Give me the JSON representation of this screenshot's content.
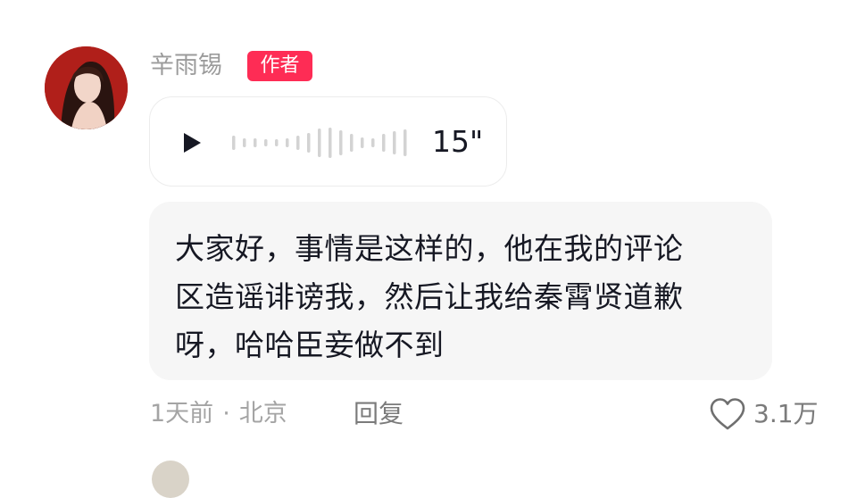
{
  "comment": {
    "username": "辛雨锡",
    "author_badge": "作者",
    "voice": {
      "duration": "15\""
    },
    "text_lines": [
      "大家好，事情是这样的，他在我的评论",
      "区造谣诽谤我，然后让我给秦霄贤道歉",
      "呀，哈哈臣妾做不到"
    ],
    "time_ago": "1天前",
    "separator": "·",
    "location": "北京",
    "reply_label": "回复",
    "like_count": "3.1万"
  },
  "icons": {
    "play": "play-icon",
    "heart": "heart-icon"
  },
  "colors": {
    "author_badge": "#fe2c55",
    "muted_text": "#a4a4a4",
    "bubble_bg": "#f6f6f6"
  }
}
